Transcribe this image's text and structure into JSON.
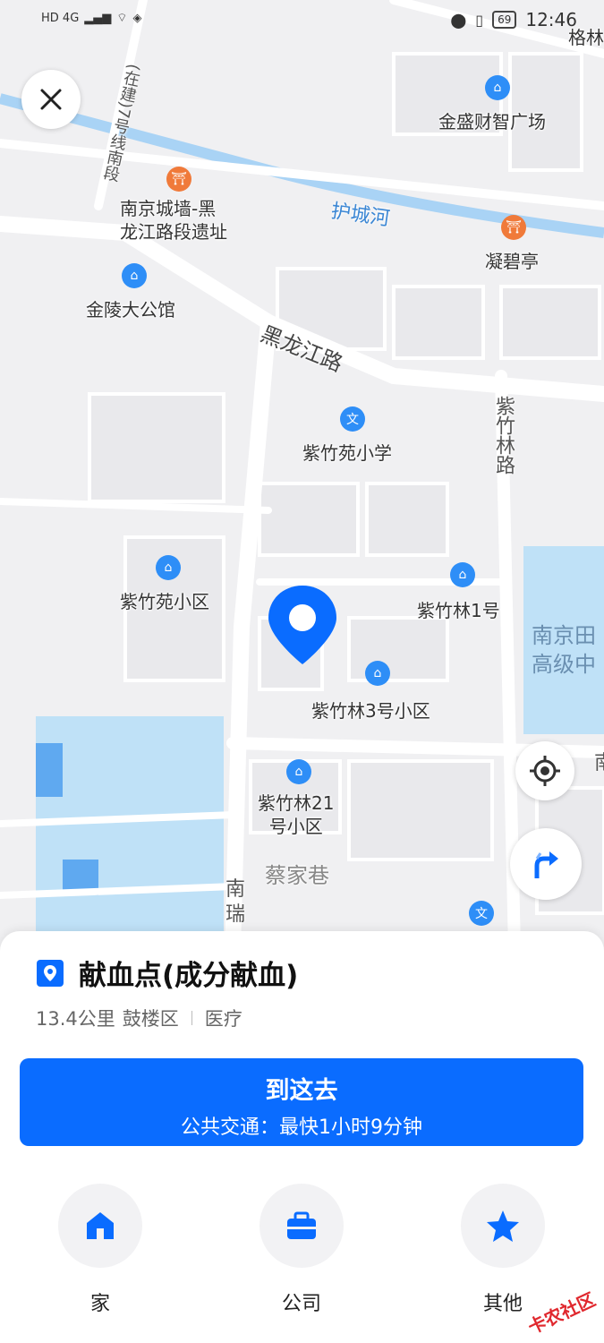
{
  "status": {
    "left": "HD 4G",
    "battery": "69",
    "time": "12:46",
    "corner_text": "格林"
  },
  "map": {
    "labels": {
      "plaza": "金盛财智广场",
      "line7": "(在建)7号线南段",
      "wall": "南京城墙-黑\n龙江路段遗址",
      "river": "护城河",
      "pavilion": "凝碧亭",
      "mansion": "金陵大公馆",
      "road_hlj": "黑龙江路",
      "school": "紫竹苑小学",
      "road_zzl": "紫竹林路",
      "zzy": "紫竹苑小区",
      "zzl1": "紫竹林1号",
      "njt": "南京田\n高级中",
      "zzl3": "紫竹林3号小区",
      "zzl21": "紫竹林21\n号小区",
      "caijia": "蔡家巷",
      "nanrui": "南\n瑞",
      "right_nan": "南"
    },
    "colors": {
      "road": "#ffffff",
      "block": "#ececef",
      "river": "#a9d3f5",
      "water": "#bfe1f7",
      "marker": "#0a6cff",
      "poi_blue": "#2e8ef7",
      "poi_orange": "#f07a3a"
    }
  },
  "sheet": {
    "title": "献血点(成分献血)",
    "distance": "13.4公里",
    "district": "鼓楼区",
    "category": "医疗",
    "go_label": "到这去",
    "transit": "公共交通：最快1小时9分钟"
  },
  "shortcuts": [
    {
      "label": "家",
      "icon": "home-icon"
    },
    {
      "label": "公司",
      "icon": "briefcase-icon"
    },
    {
      "label": "其他",
      "icon": "star-icon"
    }
  ],
  "watermark": "卡农社区"
}
